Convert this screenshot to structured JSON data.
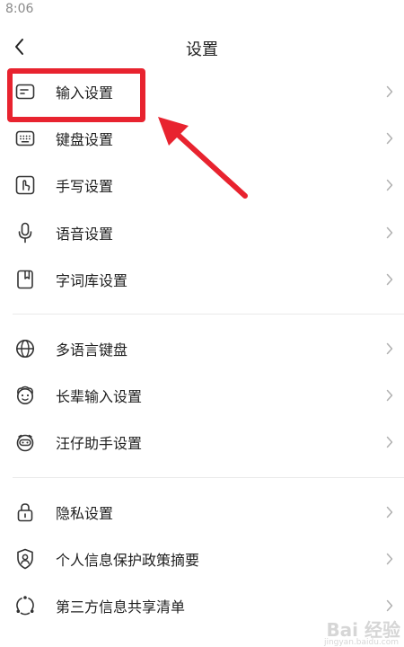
{
  "status_bar": {
    "time": "8:06"
  },
  "header": {
    "title": "设置",
    "back_icon": "chevron-left-icon"
  },
  "groups": [
    {
      "items": [
        {
          "label": "输入设置",
          "icon": "input-settings-icon"
        },
        {
          "label": "键盘设置",
          "icon": "keyboard-icon"
        },
        {
          "label": "手写设置",
          "icon": "handwriting-icon"
        },
        {
          "label": "语音设置",
          "icon": "microphone-icon"
        },
        {
          "label": "字词库设置",
          "icon": "dictionary-icon"
        }
      ]
    },
    {
      "items": [
        {
          "label": "多语言键盘",
          "icon": "globe-icon"
        },
        {
          "label": "长辈输入设置",
          "icon": "elder-face-icon"
        },
        {
          "label": "汪仔助手设置",
          "icon": "assistant-dog-icon"
        }
      ]
    },
    {
      "items": [
        {
          "label": "隐私设置",
          "icon": "lock-icon"
        },
        {
          "label": "个人信息保护政策摘要",
          "icon": "shield-user-icon"
        },
        {
          "label": "第三方信息共享清单",
          "icon": "share-circle-icon"
        }
      ]
    }
  ],
  "annotation": {
    "highlight_color": "#e8232f",
    "highlighted_item": "输入设置"
  },
  "watermark": {
    "text": "Bai 经验",
    "sub": "jingyan.baidu.com"
  }
}
